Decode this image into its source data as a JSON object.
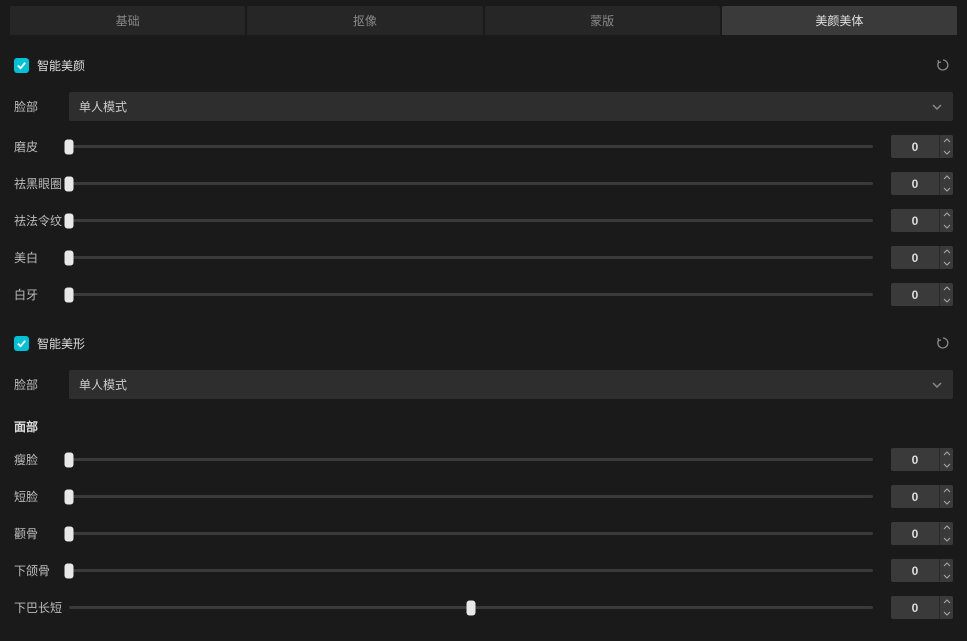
{
  "tabs": {
    "t0": "基础",
    "t1": "抠像",
    "t2": "蒙版",
    "t3": "美颜美体"
  },
  "section1": {
    "title": "智能美颜",
    "modeLabel": "脸部",
    "modeValue": "单人模式",
    "sliders": {
      "s0": {
        "label": "磨皮",
        "value": "0",
        "pos": 0
      },
      "s1": {
        "label": "祛黑眼圈",
        "value": "0",
        "pos": 0
      },
      "s2": {
        "label": "祛法令纹",
        "value": "0",
        "pos": 0
      },
      "s3": {
        "label": "美白",
        "value": "0",
        "pos": 0
      },
      "s4": {
        "label": "白牙",
        "value": "0",
        "pos": 0
      }
    }
  },
  "section2": {
    "title": "智能美形",
    "modeLabel": "脸部",
    "modeValue": "单人模式",
    "groupLabel": "面部",
    "sliders": {
      "s0": {
        "label": "瘦脸",
        "value": "0",
        "pos": 0
      },
      "s1": {
        "label": "短脸",
        "value": "0",
        "pos": 0
      },
      "s2": {
        "label": "颧骨",
        "value": "0",
        "pos": 0
      },
      "s3": {
        "label": "下颌骨",
        "value": "0",
        "pos": 0
      },
      "s4": {
        "label": "下巴长短",
        "value": "0",
        "pos": 50
      }
    }
  }
}
